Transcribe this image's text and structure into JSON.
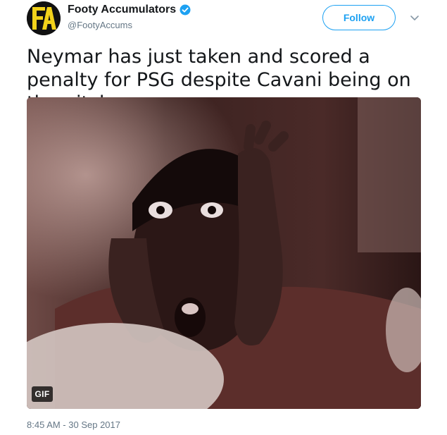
{
  "author": {
    "display_name": "Footy Accumulators",
    "handle": "@FootyAccums",
    "verified": true,
    "avatar_logo": "FA"
  },
  "actions": {
    "follow_label": "Follow",
    "more_icon": "chevron-down-icon"
  },
  "tweet": {
    "text": "Neymar has just taken and scored a penalty for PSG despite Cavani being on the pitch..",
    "media_badge": "GIF",
    "timestamp": "8:45 AM - 30 Sep 2017"
  },
  "colors": {
    "accent": "#1da1f2",
    "secondary_text": "#657786",
    "primary_text": "#14171a"
  }
}
